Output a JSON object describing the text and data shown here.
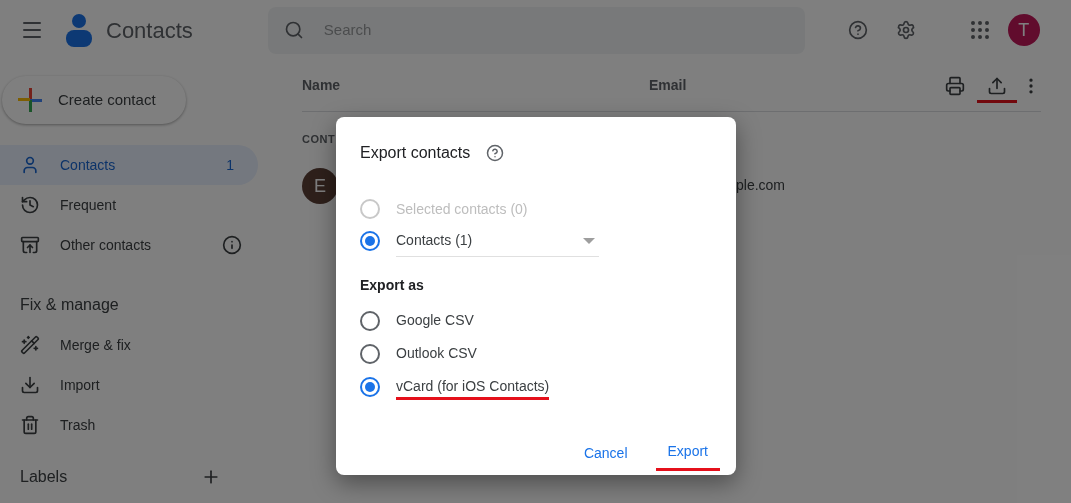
{
  "header": {
    "app_title": "Contacts",
    "search": {
      "placeholder": "Search"
    },
    "avatar_letter": "T"
  },
  "sidebar": {
    "create_button": "Create contact",
    "items": [
      {
        "kind": "contacts",
        "label": "Contacts",
        "count": "1",
        "selected": true
      },
      {
        "kind": "frequent",
        "label": "Frequent",
        "selected": false
      },
      {
        "kind": "other",
        "label": "Other contacts",
        "selected": false
      }
    ],
    "section_title": "Fix & manage",
    "manage_items": [
      {
        "kind": "merge",
        "label": "Merge & fix"
      },
      {
        "kind": "import",
        "label": "Import"
      },
      {
        "kind": "trash",
        "label": "Trash"
      }
    ],
    "labels_title": "Labels"
  },
  "table": {
    "columns": [
      "Name",
      "Email"
    ],
    "section_label": "CONT",
    "rows": [
      {
        "avatar_letter": "E",
        "email": "ple.com"
      }
    ],
    "export_underlined": true
  },
  "dialog": {
    "title": "Export contacts",
    "scope_options": [
      {
        "label": "Selected contacts (0)",
        "selected": false,
        "disabled": true
      },
      {
        "label": "Contacts (1)",
        "selected": true,
        "disabled": false,
        "kind": "dropdown"
      }
    ],
    "format_title": "Export as",
    "format_options": [
      {
        "label": "Google CSV",
        "selected": false,
        "underlined": false
      },
      {
        "label": "Outlook CSV",
        "selected": false,
        "underlined": false
      },
      {
        "label": "vCard (for iOS Contacts)",
        "selected": true,
        "underlined": true
      }
    ],
    "buttons": [
      {
        "label": "Cancel",
        "underlined": false
      },
      {
        "label": "Export",
        "underlined": true
      }
    ]
  }
}
